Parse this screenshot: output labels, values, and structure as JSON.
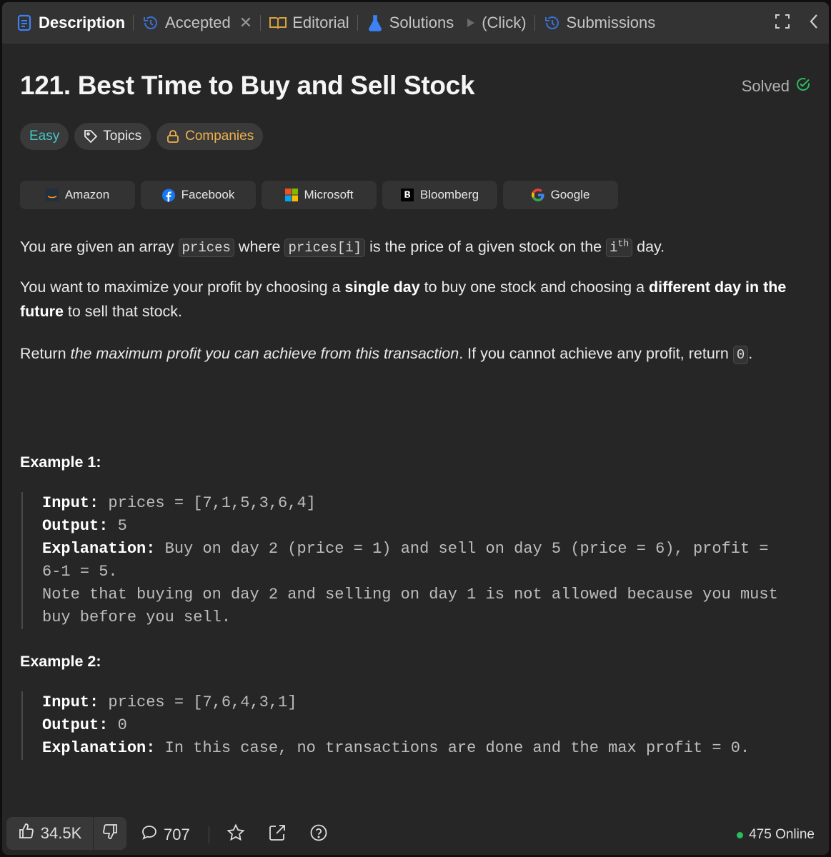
{
  "tabs": [
    {
      "label": "Description",
      "icon": "description-icon"
    },
    {
      "label": "Accepted",
      "icon": "history-icon"
    },
    {
      "label": "Editorial",
      "icon": "book-icon"
    },
    {
      "label": "Solutions",
      "icon": "flask-icon"
    },
    {
      "label": "(Click)",
      "icon": "play-icon"
    },
    {
      "label": "Submissions",
      "icon": "history-icon"
    }
  ],
  "problem": {
    "title": "121. Best Time to Buy and Sell Stock",
    "status": "Solved",
    "difficulty": "Easy",
    "topics_label": "Topics",
    "companies_label": "Companies"
  },
  "companies": [
    "Amazon",
    "Facebook",
    "Microsoft",
    "Bloomberg",
    "Google"
  ],
  "description": {
    "p1_a": "You are given an array ",
    "p1_code1": "prices",
    "p1_b": " where ",
    "p1_code2": "prices[i]",
    "p1_c": " is the price of a given stock on the ",
    "p1_code3": "i",
    "p1_sup": "th",
    "p1_d": " day.",
    "p2_a": "You want to maximize your profit by choosing a ",
    "p2_b1": "single day",
    "p2_c": " to buy one stock and choosing a ",
    "p2_b2": "different day in the future",
    "p2_d": " to sell that stock.",
    "p3_a": "Return ",
    "p3_i": "the maximum profit you can achieve from this transaction",
    "p3_b": ". If you cannot achieve any profit, return ",
    "p3_code": "0",
    "p3_c": "."
  },
  "examples": [
    {
      "title": "Example 1:",
      "input_label": "Input:",
      "input": " prices = [7,1,5,3,6,4]",
      "output_label": "Output:",
      "output": " 5",
      "explanation_label": "Explanation:",
      "explanation_l1": " Buy on day 2 (price = 1) and sell on day 5 (price = 6), profit =",
      "explanation_l2": "6-1 = 5.",
      "note_l1": "Note that buying on day 2 and selling on day 1 is not allowed because you must",
      "note_l2": "buy before you sell."
    },
    {
      "title": "Example 2:",
      "input_label": "Input:",
      "input": " prices = [7,6,4,3,1]",
      "output_label": "Output:",
      "output": " 0",
      "explanation_label": "Explanation:",
      "explanation_l1": " In this case, no transactions are done and the max profit = 0."
    }
  ],
  "footer": {
    "likes": "34.5K",
    "comments": "707",
    "online": "475 Online"
  },
  "colors": {
    "panel": "#262626",
    "tabbar": "#333333",
    "easy": "#46c6c2",
    "companies": "#f0b14e",
    "solved": "#2cbb5d",
    "description_icon": "#3b82f6"
  }
}
